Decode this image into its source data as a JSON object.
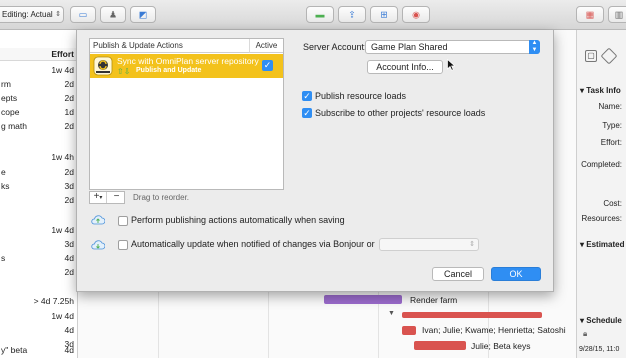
{
  "toolbar": {
    "editing_label": "Editing: Actual"
  },
  "outline": {
    "effort_header": "Effort",
    "rows": [
      {
        "title": "",
        "effort": "1w 4d"
      },
      {
        "title": "rm",
        "effort": "2d"
      },
      {
        "title": "epts",
        "effort": "2d"
      },
      {
        "title": "cope",
        "effort": "1d"
      },
      {
        "title": "g math",
        "effort": "2d"
      },
      {
        "title": "",
        "effort": "1w 4h"
      },
      {
        "title": "e",
        "effort": "2d"
      },
      {
        "title": "ks",
        "effort": "3d"
      },
      {
        "title": "",
        "effort": "2d"
      },
      {
        "title": "",
        "effort": "1w 4d"
      },
      {
        "title": "",
        "effort": "3d"
      },
      {
        "title": "s",
        "effort": "4d"
      },
      {
        "title": "",
        "effort": "2d"
      },
      {
        "title": "",
        "effort": "> 4d 7.25h"
      },
      {
        "title": "",
        "effort": "1w 4d"
      },
      {
        "title": "",
        "effort": "4d"
      },
      {
        "title": "",
        "effort": "3d"
      },
      {
        "title": "y\" beta",
        "effort": "4d"
      }
    ]
  },
  "gantt": {
    "labels": [
      {
        "text": "Render farm"
      },
      {
        "text": "Ivan; Julie; Kwame; Henrietta; Satoshi"
      },
      {
        "text": "Julie; Beta keys"
      }
    ]
  },
  "inspector": {
    "task_info": "Task Info",
    "name": "Name:",
    "type": "Type:",
    "effort": "Effort:",
    "completed": "Completed:",
    "cost": "Cost:",
    "resources": "Resources:",
    "estimated": "Estimated",
    "schedule": "Schedule",
    "start_date": "9/28/15, 11:0"
  },
  "sheet": {
    "table": {
      "col_actions": "Publish & Update Actions",
      "col_active": "Active",
      "rows": [
        {
          "title": "Sync with OmniPlan server repository",
          "subtitle": "Publish and Update",
          "active": true
        }
      ]
    },
    "segmented": {
      "add": "+",
      "add_menu": "▾",
      "remove": "−"
    },
    "drag_hint": "Drag to reorder.",
    "server_account_label": "Server Account:",
    "server_account_value": "Game Plan Shared",
    "account_info_button": "Account Info...",
    "publish_loads": {
      "label": "Publish resource loads",
      "checked": true
    },
    "subscribe_loads": {
      "label": "Subscribe to other projects' resource loads",
      "checked": true
    },
    "auto_publish": {
      "label": "Perform publishing actions automatically when saving",
      "checked": false
    },
    "auto_update": {
      "label": "Automatically update when notified of changes via Bonjour or",
      "checked": false
    },
    "cancel_button": "Cancel",
    "ok_button": "OK"
  },
  "colors": {
    "selection": "#f3c21c",
    "accent": "#2f8ef3",
    "gantt_bar_red": "#d9534f",
    "gantt_bar_purple": "#9b6bcc"
  }
}
